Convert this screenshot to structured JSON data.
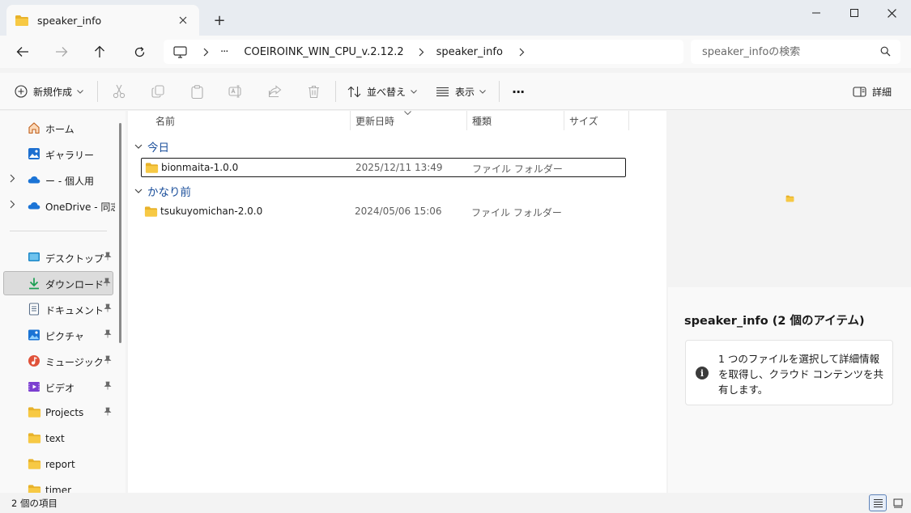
{
  "window": {
    "tab_title": "speaker_info",
    "new_tab": "+"
  },
  "address": {
    "more": "···",
    "crumbs": [
      "COEIROINK_WIN_CPU_v.2.12.2",
      "speaker_info"
    ]
  },
  "search": {
    "placeholder": "speaker_infoの検索"
  },
  "toolbar": {
    "new_label": "新規作成",
    "sort_label": "並べ替え",
    "view_label": "表示",
    "more": "···",
    "details_label": "詳細"
  },
  "sidebar": {
    "items": [
      {
        "label": "ホーム"
      },
      {
        "label": "ギャラリー"
      },
      {
        "label": "ー - 個人用"
      },
      {
        "label": "OneDrive - 同志"
      },
      {
        "label": "デスクトップ"
      },
      {
        "label": "ダウンロード"
      },
      {
        "label": "ドキュメント"
      },
      {
        "label": "ピクチャ"
      },
      {
        "label": "ミュージック"
      },
      {
        "label": "ビデオ"
      },
      {
        "label": "Projects"
      },
      {
        "label": "text"
      },
      {
        "label": "report"
      },
      {
        "label": "timer"
      }
    ]
  },
  "columns": {
    "name": "名前",
    "date": "更新日時",
    "type": "種類",
    "size": "サイズ"
  },
  "groups": [
    {
      "label": "今日",
      "files": [
        {
          "name": "bionmaita-1.0.0",
          "date": "2025/12/11 13:49",
          "type": "ファイル フォルダー"
        }
      ]
    },
    {
      "label": "かなり前",
      "files": [
        {
          "name": "tsukuyomichan-2.0.0",
          "date": "2024/05/06 15:06",
          "type": "ファイル フォルダー"
        }
      ]
    }
  ],
  "details": {
    "title": "speaker_info (2 個のアイテム)",
    "info_text": "1 つのファイルを選択して詳細情報を取得し、クラウド コンテンツを共有します。",
    "info_icon": "i"
  },
  "status": {
    "item_count": "2 個の項目"
  },
  "colors": {
    "folder": "#f7c944",
    "folder_dark": "#e8b22a",
    "accent": "#1b4f9b",
    "onedrive": "#1b74d6"
  }
}
